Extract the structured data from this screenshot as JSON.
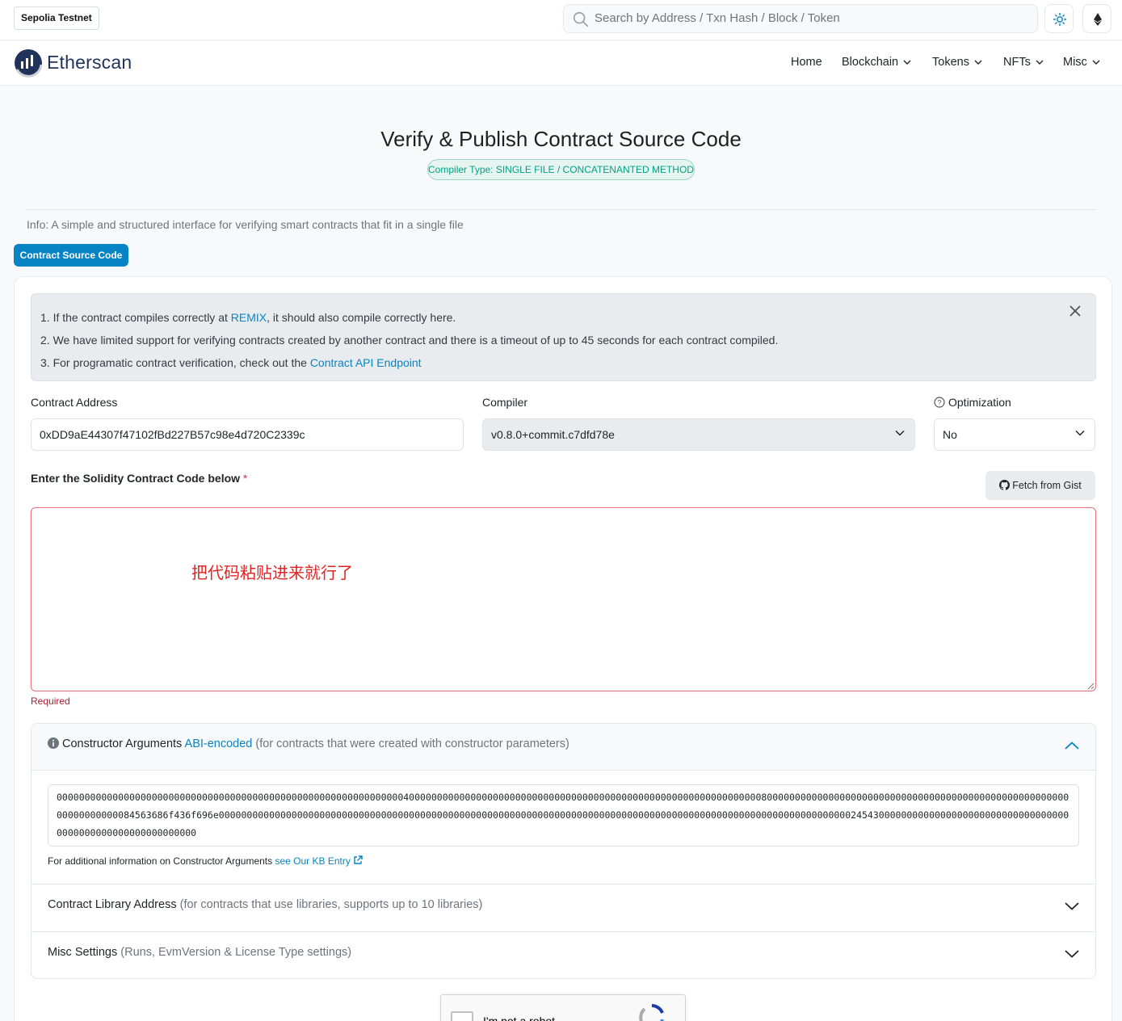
{
  "topbar": {
    "network": "Sepolia Testnet",
    "search_placeholder": "Search by Address / Txn Hash / Block / Token"
  },
  "nav": {
    "brand": "Etherscan",
    "items": [
      "Home",
      "Blockchain",
      "Tokens",
      "NFTs",
      "Misc"
    ]
  },
  "header": {
    "title": "Verify & Publish Contract Source Code",
    "compiler_type": "Compiler Type: SINGLE FILE / CONCATENANTED METHOD",
    "info": "Info: A simple and structured interface for verifying smart contracts that fit in a single file",
    "tab": "Contract Source Code"
  },
  "alert": {
    "line1_pre": "1. If the contract compiles correctly at ",
    "line1_link": "REMIX",
    "line1_post": ", it should also compile correctly here.",
    "line2": "2. We have limited support for verifying contracts created by another contract and there is a timeout of up to 45 seconds for each contract compiled.",
    "line3_pre": "3. For programatic contract verification, check out the ",
    "line3_link": "Contract API Endpoint"
  },
  "form": {
    "address_label": "Contract Address",
    "address_value": "0xDD9aE44307f47102fBd227B57c98e4d720C2339c",
    "compiler_label": "Compiler",
    "compiler_value": "v0.8.0+commit.c7dfd78e",
    "optimization_label": "Optimization",
    "optimization_value": "No",
    "code_label": "Enter the Solidity Contract Code below",
    "code_required_mark": "*",
    "fetch_gist": "Fetch from Gist",
    "code_annotation": "把代码粘贴进来就行了",
    "required_text": "Required"
  },
  "constructor": {
    "title": "Constructor Arguments",
    "link": "ABI-encoded",
    "note": "(for contracts that were created with constructor parameters)",
    "args": "000000000000000000000000000000000000000000000000000000000000004000000000000000000000000000000000000000000000000000000000000000800000000000000000000000000000000000000000000000000000000000000000084563686f436f696e000000000000000000000000000000000000000000000000000000000000000000000000000000000000000000000000000000000000000002454300000000000000000000000000000000000000000000000000000000000",
    "kb_text": "For additional information on Constructor Arguments ",
    "kb_link": "see Our KB Entry"
  },
  "library": {
    "title": "Contract Library Address",
    "note": "(for contracts that use libraries, supports up to 10 libraries)"
  },
  "misc": {
    "title": "Misc Settings",
    "note": "(Runs, EvmVersion & License Type settings)"
  },
  "captcha": {
    "label": "I'm not a robot"
  },
  "colors": {
    "primary": "#0784c3",
    "badge_green": "#00a186",
    "error": "#dc3545",
    "brand_navy": "#21325b"
  }
}
